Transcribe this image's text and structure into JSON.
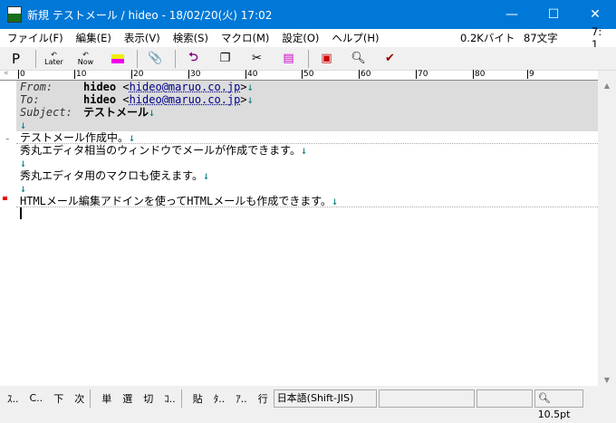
{
  "title": "新規 テストメール / hideo - 18/02/20(火) 17:02",
  "menu": [
    "ファイル(F)",
    "編集(E)",
    "表示(V)",
    "検索(S)",
    "マクロ(M)",
    "設定(O)",
    "ヘルプ(H)"
  ],
  "menu_info": {
    "size": "0.2Kバイト",
    "chars": "87文字",
    "pos": "7: 1"
  },
  "toolbar": {
    "p": "P",
    "later": "Later",
    "now": "Now"
  },
  "ruler": [
    "0",
    "10",
    "20",
    "30",
    "40",
    "50",
    "60",
    "70",
    "80",
    "9"
  ],
  "header": {
    "from_label": "From:",
    "from_name": "hideo",
    "from_email": "hideo@maruo.co.jp",
    "to_label": "To:",
    "to_name": "hideo",
    "to_email": "hideo@maruo.co.jp",
    "subject_label": "Subject:",
    "subject": "テストメール"
  },
  "body": [
    "テストメール作成中。",
    "秀丸エディタ相当のウィンドウでメールが作成できます。",
    "",
    "秀丸エディタ用のマクロも使えます。",
    "",
    "HTMLメール編集アドインを使ってHTMLメールも作成できます。"
  ],
  "newline": "↓",
  "status": {
    "buttons": [
      "ｽ..",
      "C..",
      "下",
      "次",
      "単",
      "選",
      "切",
      "ｺ..",
      "貼",
      "ﾀ..",
      "ｱ..",
      "行"
    ],
    "encoding": "日本語(Shift-JIS)",
    "zoom": "10.5pt"
  }
}
